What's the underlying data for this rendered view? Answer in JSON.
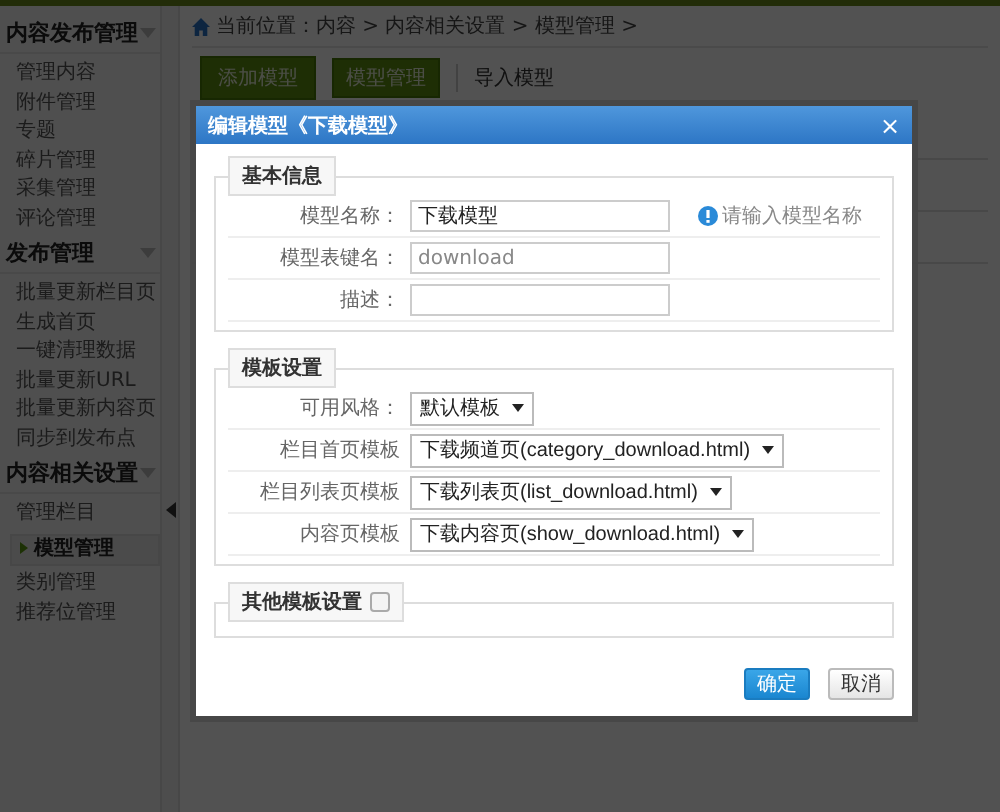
{
  "sidebar": {
    "sections": [
      {
        "title": "内容发布管理",
        "items": [
          {
            "label": "管理内容",
            "selected": false
          },
          {
            "label": "附件管理",
            "selected": false
          },
          {
            "label": "专题",
            "selected": false
          },
          {
            "label": "碎片管理",
            "selected": false
          },
          {
            "label": "采集管理",
            "selected": false
          },
          {
            "label": "评论管理",
            "selected": false
          }
        ]
      },
      {
        "title": "发布管理",
        "items": [
          {
            "label": "批量更新栏目页",
            "selected": false
          },
          {
            "label": "生成首页",
            "selected": false
          },
          {
            "label": "一键清理数据",
            "selected": false
          },
          {
            "label": "批量更新URL",
            "selected": false
          },
          {
            "label": "批量更新内容页",
            "selected": false
          },
          {
            "label": "同步到发布点",
            "selected": false
          }
        ]
      },
      {
        "title": "内容相关设置",
        "items": [
          {
            "label": "管理栏目",
            "selected": false
          },
          {
            "label": "模型管理",
            "selected": true
          },
          {
            "label": "类别管理",
            "selected": false
          },
          {
            "label": "推荐位管理",
            "selected": false
          }
        ]
      }
    ]
  },
  "breadcrumb": "当前位置：内容 > 内容相关设置 > 模型管理 >",
  "toolbar": [
    {
      "label": "添加模型",
      "kind": "button"
    },
    {
      "label": "模型管理",
      "kind": "button"
    },
    {
      "label": "导入模型",
      "kind": "link"
    }
  ],
  "dialog": {
    "title": "编辑模型《下载模型》",
    "close": "×",
    "sections": [
      {
        "legend": "基本信息",
        "fields": [
          {
            "label": "模型名称：",
            "kind": "input",
            "value": "下载模型",
            "hint": "请输入模型名称"
          },
          {
            "label": "模型表键名：",
            "kind": "input",
            "placeholder": "download"
          },
          {
            "label": "描述：",
            "kind": "input"
          }
        ]
      },
      {
        "legend": "模板设置",
        "fields": [
          {
            "label": "可用风格：",
            "kind": "select",
            "value": "默认模板"
          },
          {
            "label": "栏目首页模板",
            "kind": "select",
            "value": "下载频道页(category_download.html)"
          },
          {
            "label": "栏目列表页模板",
            "kind": "select",
            "value": "下载列表页(list_download.html)"
          },
          {
            "label": "内容页模板",
            "kind": "select",
            "value": "下载内容页(show_download.html)"
          }
        ]
      },
      {
        "legend": "其他模板设置",
        "checkbox": {
          "checked": false
        }
      }
    ],
    "buttons": [
      {
        "label": "确定",
        "kind": "primary"
      },
      {
        "label": "取消",
        "kind": "secondary"
      }
    ]
  }
}
